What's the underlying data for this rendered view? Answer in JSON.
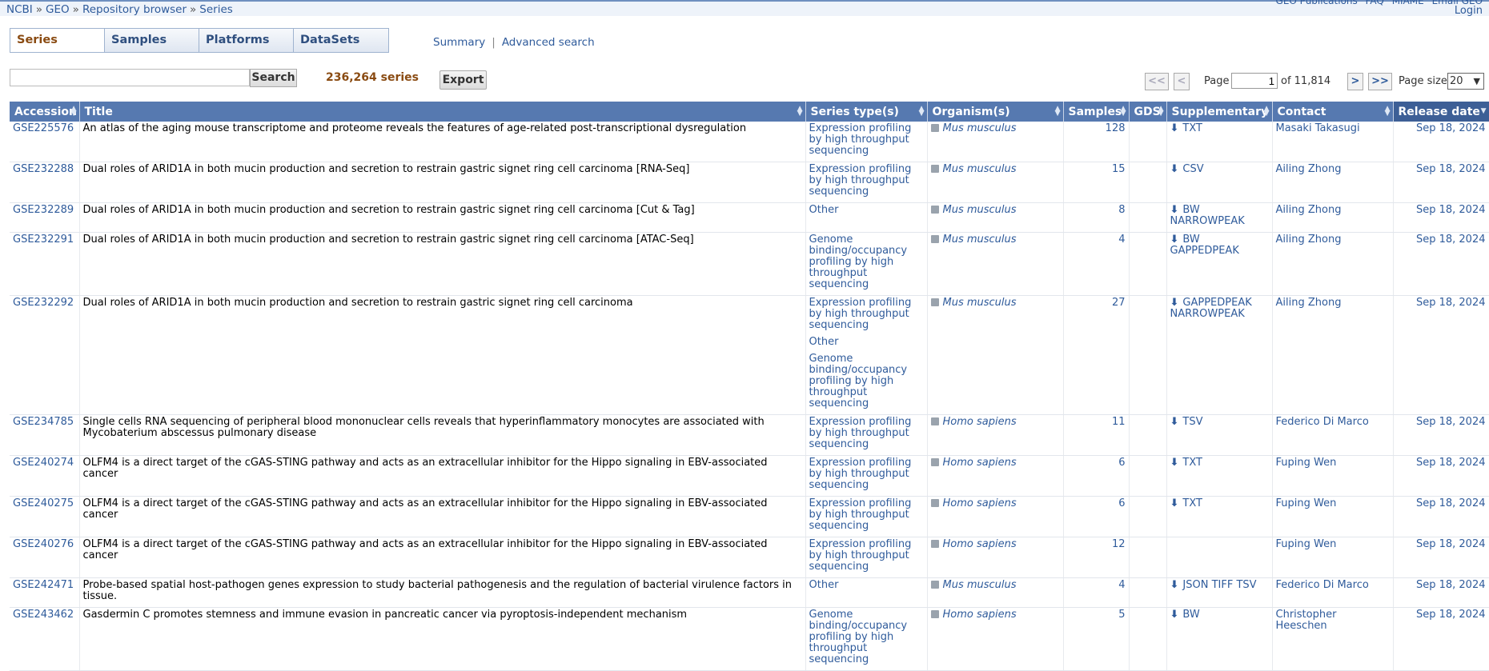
{
  "breadcrumb": [
    "NCBI",
    "GEO",
    "Repository browser",
    "Series"
  ],
  "top_links": [
    "GEO Publications",
    "FAQ",
    "MIAME",
    "Email GEO"
  ],
  "login": "Login",
  "tabs": [
    "Series",
    "Samples",
    "Platforms",
    "DataSets"
  ],
  "view_links": {
    "summary": "Summary",
    "advanced": "Advanced search"
  },
  "search": {
    "value": "",
    "button": "Search"
  },
  "count": "236,264 series",
  "export": "Export",
  "pager": {
    "first": "<<",
    "prev": "<",
    "page_label": "Page",
    "page": "1",
    "of": "of 11,814",
    "next": ">",
    "last": ">>",
    "size_label": "Page size",
    "size": "20"
  },
  "columns": [
    "Accession",
    "Title",
    "Series type(s)",
    "Organism(s)",
    "Samples",
    "GDS",
    "Supplementary",
    "Contact",
    "Release date"
  ],
  "rows": [
    {
      "acc": "GSE225576",
      "title": "An atlas of the aging mouse transcriptome and proteome reveals the features of age-related post-transcriptional dysregulation",
      "types": [
        "Expression profiling by high throughput sequencing"
      ],
      "org": "Mus musculus",
      "samples": "128",
      "gds": "",
      "supp": "TXT",
      "contact": "Masaki Takasugi",
      "date": "Sep 18, 2024"
    },
    {
      "acc": "GSE232288",
      "title": "Dual roles of ARID1A in both mucin production and secretion to restrain gastric signet ring cell carcinoma [RNA-Seq]",
      "types": [
        "Expression profiling by high throughput sequencing"
      ],
      "org": "Mus musculus",
      "samples": "15",
      "gds": "",
      "supp": "CSV",
      "contact": "Ailing Zhong",
      "date": "Sep 18, 2024"
    },
    {
      "acc": "GSE232289",
      "title": "Dual roles of ARID1A in both mucin production and secretion to restrain gastric signet ring cell carcinoma [Cut & Tag]",
      "types": [
        "Other"
      ],
      "org": "Mus musculus",
      "samples": "8",
      "gds": "",
      "supp": "BW NARROWPEAK",
      "contact": "Ailing Zhong",
      "date": "Sep 18, 2024"
    },
    {
      "acc": "GSE232291",
      "title": "Dual roles of ARID1A in both mucin production and secretion to restrain gastric signet ring cell carcinoma [ATAC-Seq]",
      "types": [
        "Genome binding/occupancy profiling by high throughput sequencing"
      ],
      "org": "Mus musculus",
      "samples": "4",
      "gds": "",
      "supp": "BW GAPPEDPEAK",
      "contact": "Ailing Zhong",
      "date": "Sep 18, 2024"
    },
    {
      "acc": "GSE232292",
      "title": "Dual roles of ARID1A in both mucin production and secretion to restrain gastric signet ring cell carcinoma",
      "types": [
        "Expression profiling by high throughput sequencing",
        "Other",
        "Genome binding/occupancy profiling by high throughput sequencing"
      ],
      "org": "Mus musculus",
      "samples": "27",
      "gds": "",
      "supp": "GAPPEDPEAK NARROWPEAK",
      "contact": "Ailing Zhong",
      "date": "Sep 18, 2024"
    },
    {
      "acc": "GSE234785",
      "title": "Single cells RNA sequencing of peripheral blood mononuclear cells reveals that hyperinflammatory monocytes are associated with Mycobaterium abscessus pulmonary disease",
      "types": [
        "Expression profiling by high throughput sequencing"
      ],
      "org": "Homo sapiens",
      "samples": "11",
      "gds": "",
      "supp": "TSV",
      "contact": "Federico Di Marco",
      "date": "Sep 18, 2024"
    },
    {
      "acc": "GSE240274",
      "title": "OLFM4 is a direct target of the cGAS-STING pathway and acts as an extracellular inhibitor for the Hippo signaling in EBV-associated cancer",
      "types": [
        "Expression profiling by high throughput sequencing"
      ],
      "org": "Homo sapiens",
      "samples": "6",
      "gds": "",
      "supp": "TXT",
      "contact": "Fuping Wen",
      "date": "Sep 18, 2024"
    },
    {
      "acc": "GSE240275",
      "title": "OLFM4 is a direct target of the cGAS-STING pathway and acts as an extracellular inhibitor for the Hippo signaling in EBV-associated cancer",
      "types": [
        "Expression profiling by high throughput sequencing"
      ],
      "org": "Homo sapiens",
      "samples": "6",
      "gds": "",
      "supp": "TXT",
      "contact": "Fuping Wen",
      "date": "Sep 18, 2024"
    },
    {
      "acc": "GSE240276",
      "title": "OLFM4 is a direct target of the cGAS-STING pathway and acts as an extracellular inhibitor for the Hippo signaling in EBV-associated cancer",
      "types": [
        "Expression profiling by high throughput sequencing"
      ],
      "org": "Homo sapiens",
      "samples": "12",
      "gds": "",
      "supp": "",
      "contact": "Fuping Wen",
      "date": "Sep 18, 2024"
    },
    {
      "acc": "GSE242471",
      "title": "Probe-based spatial host-pathogen genes expression to study bacterial pathogenesis and the regulation of bacterial virulence factors in tissue.",
      "types": [
        "Other"
      ],
      "org": "Mus musculus",
      "samples": "4",
      "gds": "",
      "supp": "JSON TIFF TSV",
      "contact": "Federico Di Marco",
      "date": "Sep 18, 2024"
    },
    {
      "acc": "GSE243462",
      "title": "Gasdermin C promotes stemness and immune evasion in pancreatic cancer via pyroptosis-independent mechanism",
      "types": [
        "Genome binding/occupancy profiling by high throughput sequencing"
      ],
      "org": "Homo sapiens",
      "samples": "5",
      "gds": "",
      "supp": "BW",
      "contact": "Christopher Heeschen",
      "date": "Sep 18, 2024"
    }
  ]
}
